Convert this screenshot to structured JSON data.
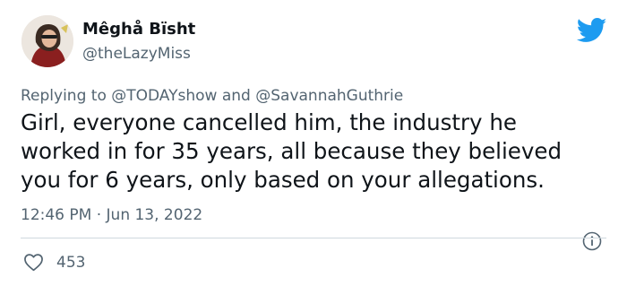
{
  "user": {
    "display_name": "Mêghå Bïsht",
    "handle": "@theLazyMiss"
  },
  "reply": {
    "prefix": "Replying to ",
    "mention_1": "@TODAYshow",
    "joiner": " and ",
    "mention_2": "@SavannahGuthrie"
  },
  "tweet": {
    "text": "Girl, everyone cancelled him, the industry he worked in for 35 years, all because they believed you for 6 years, only based on your allegations.",
    "timestamp": "12:46 PM · Jun 13, 2022"
  },
  "actions": {
    "like_count": "453"
  },
  "icons": {
    "brand": "twitter-bird-icon",
    "info": "info-icon",
    "like": "heart-icon"
  },
  "colors": {
    "twitter_blue": "#1d9bf0",
    "secondary_text": "#536471",
    "primary_text": "#0f1419"
  }
}
